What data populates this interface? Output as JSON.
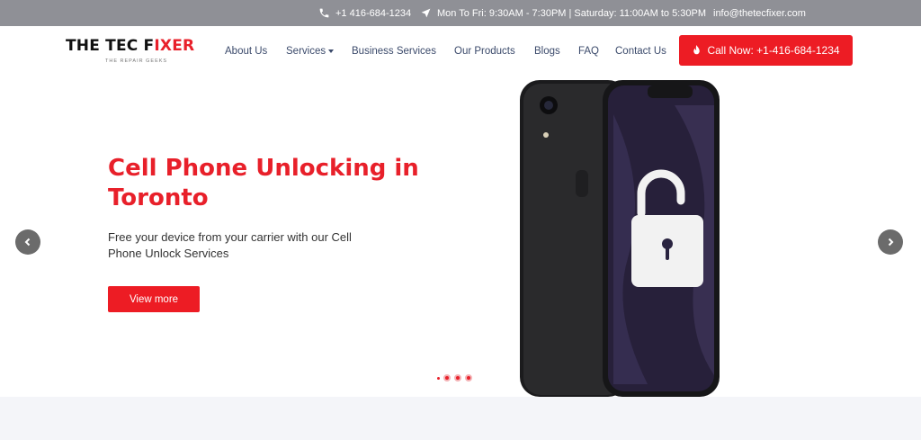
{
  "topbar": {
    "phone": "+1 416-684-1234",
    "hours": "Mon To Fri: 9:30AM - 7:30PM | Saturday: 11:00AM to 5:30PM",
    "email": "info@thetecfixer.com",
    "icons": [
      "phone-icon",
      "location-arrow-icon"
    ]
  },
  "logo": {
    "part1": "THE TEC F",
    "part2": "I",
    "part3": "XER",
    "tagline": "THE REPAIR GEEKS"
  },
  "nav": {
    "about": "About Us",
    "services": "Services",
    "business": "Business Services",
    "products": "Our Products",
    "blogs": "Blogs",
    "faq": "FAQ",
    "contact": "Contact Us"
  },
  "call_button": {
    "label": "Call Now: +1-416-684-1234",
    "icon": "fire-icon"
  },
  "hero": {
    "title": "Cell Phone Unlocking in Toronto",
    "subtitle": "Free your device from your carrier with our Cell Phone Unlock Services",
    "button": "View more",
    "slide_count": 4,
    "active_slide": 1
  },
  "colors": {
    "brand_red": "#ed1c24",
    "topbar_gray": "#8f9096",
    "nav_text": "#3b4a6b",
    "band": "#f4f5f9"
  }
}
